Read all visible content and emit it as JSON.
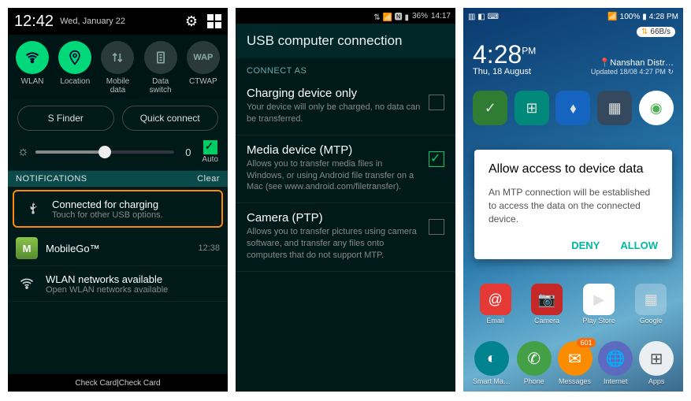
{
  "phone1": {
    "status": {
      "time": "12:42",
      "date": "Wed, January 22"
    },
    "toggles": [
      {
        "label": "WLAN",
        "on": true,
        "icon": "wifi"
      },
      {
        "label": "Location",
        "on": true,
        "icon": "location"
      },
      {
        "label": "Mobile\ndata",
        "on": false,
        "icon": "data"
      },
      {
        "label": "Data\nswitch",
        "on": false,
        "icon": "sim"
      },
      {
        "label": "CTWAP",
        "on": false,
        "icon": "wap"
      }
    ],
    "finder": "S Finder",
    "quick_connect": "Quick connect",
    "brightness_value": "0",
    "auto_label": "Auto",
    "notif_header": "NOTIFICATIONS",
    "clear": "Clear",
    "notifs": [
      {
        "title": "Connected for charging",
        "sub": "Touch for other USB options.",
        "icon": "usb",
        "time": ""
      },
      {
        "title": "MobileGo™",
        "sub": "",
        "icon": "mgo",
        "time": "12:38"
      },
      {
        "title": "WLAN networks available",
        "sub": "Open WLAN networks available",
        "icon": "wifi-open",
        "time": ""
      }
    ],
    "footer": "Check Card|Check Card"
  },
  "phone2": {
    "status": {
      "battery": "36%",
      "time": "14:17"
    },
    "title": "USB computer connection",
    "section": "CONNECT AS",
    "options": [
      {
        "title": "Charging device only",
        "desc": "Your device will only be charged, no data can be transferred.",
        "checked": false
      },
      {
        "title": "Media device (MTP)",
        "desc": "Allows you to transfer media files in Windows, or using Android file transfer on a Mac (see www.android.com/filetransfer).",
        "checked": true
      },
      {
        "title": "Camera (PTP)",
        "desc": "Allows you to transfer pictures using camera software, and transfer any files onto computers that do not support MTP.",
        "checked": false
      }
    ]
  },
  "phone3": {
    "status": {
      "battery": "100%",
      "time": "4:28 PM",
      "speed": "66B/s"
    },
    "clock": {
      "time": "4:28",
      "pm": "PM",
      "date": "Thu, 18 August"
    },
    "location": {
      "place": "Nanshan Distr…",
      "updated": "Updated 18/08 4:27 PM"
    },
    "dialog": {
      "title": "Allow access to device data",
      "body": "An MTP connection will be established to access the data on the connected device.",
      "deny": "DENY",
      "allow": "ALLOW"
    },
    "row2": [
      {
        "label": "Email",
        "icon": "email",
        "bg": "#e53935"
      },
      {
        "label": "Camera",
        "icon": "camera",
        "bg": "#d32f2f"
      },
      {
        "label": "Play Store",
        "icon": "play",
        "bg": "#fff"
      },
      {
        "label": "Google",
        "icon": "google",
        "bg": "#fff"
      }
    ],
    "dock": [
      {
        "label": "Smart Ma…",
        "icon": "smart",
        "bg": "#0097a7"
      },
      {
        "label": "Phone",
        "icon": "phone",
        "bg": "#4caf50",
        "badge": ""
      },
      {
        "label": "Messages",
        "icon": "msg",
        "bg": "#ff9800",
        "badge": "601"
      },
      {
        "label": "Internet",
        "icon": "globe",
        "bg": "#3f51b5"
      },
      {
        "label": "Apps",
        "icon": "apps",
        "bg": "#eceff1"
      }
    ]
  }
}
